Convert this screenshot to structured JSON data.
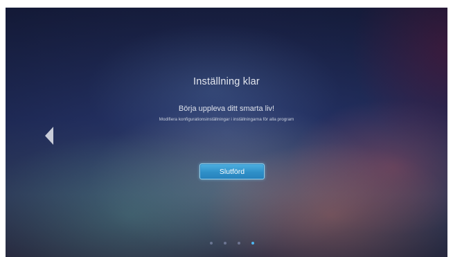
{
  "setup": {
    "title": "Inställning klar",
    "subtitle": "Börja uppleva ditt smarta liv!",
    "description": "Modifiera konfigurationsinställningar i inställningarna för alla program",
    "done_label": "Slutförd"
  },
  "pagination": {
    "total_pages": 4,
    "current_page": 4
  },
  "colors": {
    "accent": "#3498d2",
    "active_dot": "#4fb6ef",
    "text": "#e4e7ef"
  },
  "icons": {
    "prev": "left-triangle-arrow"
  }
}
